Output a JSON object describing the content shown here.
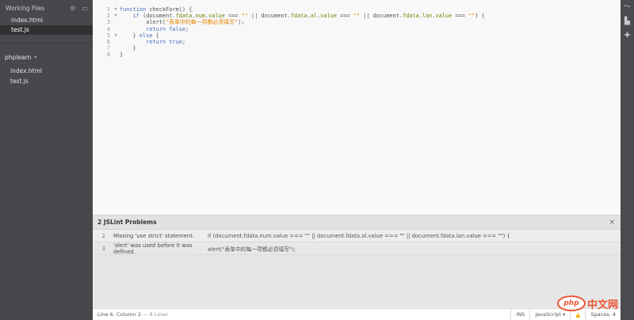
{
  "sidebar": {
    "working_files_title": "Working Files",
    "working_files": [
      {
        "name": "index.html",
        "selected": false
      },
      {
        "name": "test.js",
        "selected": true
      }
    ],
    "project_name": "phplearn",
    "project_files": [
      {
        "name": "index.html"
      },
      {
        "name": "test.js"
      }
    ]
  },
  "editor": {
    "line_numbers": [
      "1",
      "2",
      "3",
      "4",
      "5",
      "6",
      "7",
      "8"
    ]
  },
  "problems": {
    "title": "2 JSLint Problems",
    "close": "×",
    "rows": [
      {
        "line": "2",
        "message": "Missing 'use strict' statement.",
        "code": "if (document.fdata.num.value === \"\" || document.fdata.al.value === \"\" || document.fdata.lan.value === \"\") {"
      },
      {
        "line": "3",
        "message": "'alert' was used before it was defined.",
        "code": "alert(\"表单中的每一项都必须填写\");"
      }
    ]
  },
  "statusbar": {
    "position": "Line 6, Column 2",
    "lines": "— 8 Lines",
    "mode": "INS",
    "language": "JavaScript",
    "spaces": "Spaces: 4"
  },
  "watermark": {
    "logo": "php",
    "text": "中文网"
  },
  "colors": {
    "sidebar_bg": "#47484b",
    "keyword": "#446fbd",
    "property": "#6d8600",
    "string": "#e88501"
  }
}
